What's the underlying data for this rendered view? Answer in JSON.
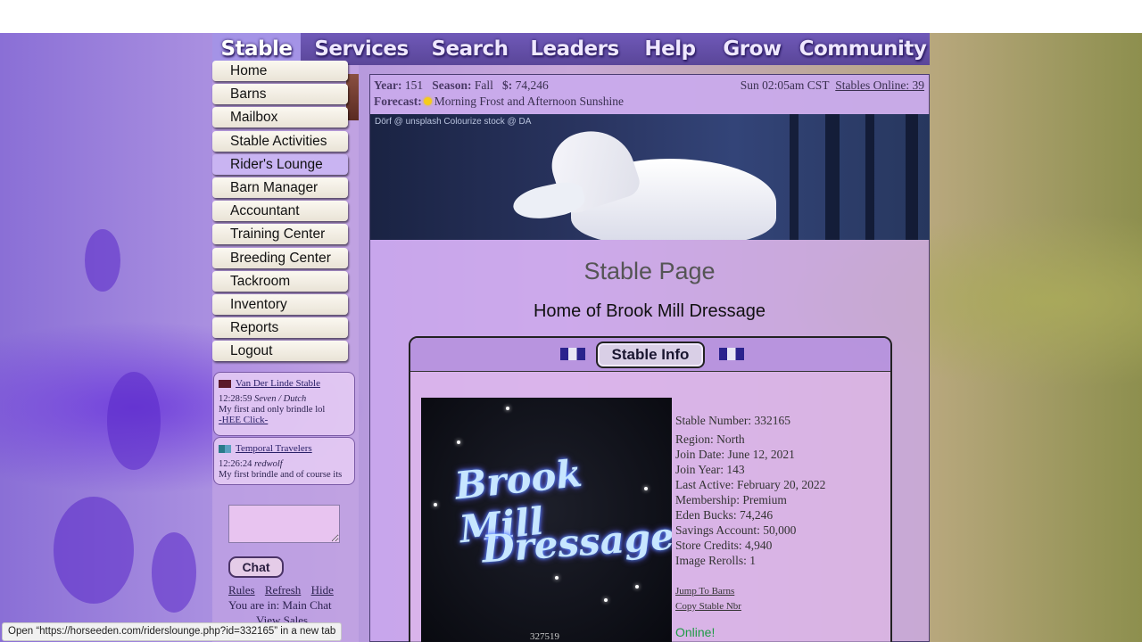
{
  "topnav": [
    "Stable",
    "Services",
    "Search",
    "Leaders",
    "Help",
    "Grow",
    "Community"
  ],
  "dropdown": [
    "Home",
    "Barns",
    "Mailbox",
    "Stable Activities",
    "Rider's Lounge",
    "Barn Manager",
    "Accountant",
    "Training Center",
    "Breeding Center",
    "Tackroom",
    "Inventory",
    "Reports",
    "Logout"
  ],
  "chat": {
    "posts": [
      {
        "stable": "Van Der Linde Stable",
        "time": "12:28:59",
        "who": "Seven / Dutch",
        "msg": "My first and only brindle lol",
        "link": "-HEE Click-",
        "flag_color": "#5a1a2a"
      },
      {
        "stable": "Temporal Travelers",
        "time": "12:26:24",
        "who": "redwolf",
        "msg": "My first brindle and of course its",
        "flag_color": "#2a7a8a"
      }
    ],
    "chat_button": "Chat",
    "links": [
      "Rules",
      "Refresh",
      "Hide"
    ],
    "room": "You are in: Main Chat",
    "view_sales": "View Sales"
  },
  "status_url": "Open “https://horseeden.com/riderslounge.php?id=332165” in a new tab",
  "infobar": {
    "year_label": "Year:",
    "year": "151",
    "season_label": "Season:",
    "season": "Fall",
    "money_label": "$:",
    "money": "74,246",
    "forecast_label": "Forecast:",
    "forecast": "Morning Frost and Afternoon Sunshine",
    "clock": "Sun 02:05am CST",
    "online_link": "Stables Online: 39"
  },
  "banner_credit": "Dörf @ unsplash    Colourize stock @ DA",
  "page_title": "Stable Page",
  "page_subtitle": "Home of Brook Mill Dressage",
  "tab_label": "Stable Info",
  "stable_image": {
    "line1": "Brook Mill",
    "line2": "Dressage",
    "number": "327519"
  },
  "details": {
    "stable_number": "Stable Number:  332165",
    "region": "Region: North",
    "join_date": "Join Date: June 12, 2021",
    "join_year": "Join Year: 143",
    "last_active": "Last Active: February 20, 2022",
    "membership": "Membership: Premium",
    "eden_bucks": "Eden Bucks: 74,246",
    "savings": "Savings Account: 50,000",
    "store_credits": "Store Credits: 4,940",
    "rerolls": "Image Rerolls: 1",
    "jump_link": "Jump To Barns",
    "copy_link": "Copy Stable Nbr",
    "online": "Online!"
  }
}
